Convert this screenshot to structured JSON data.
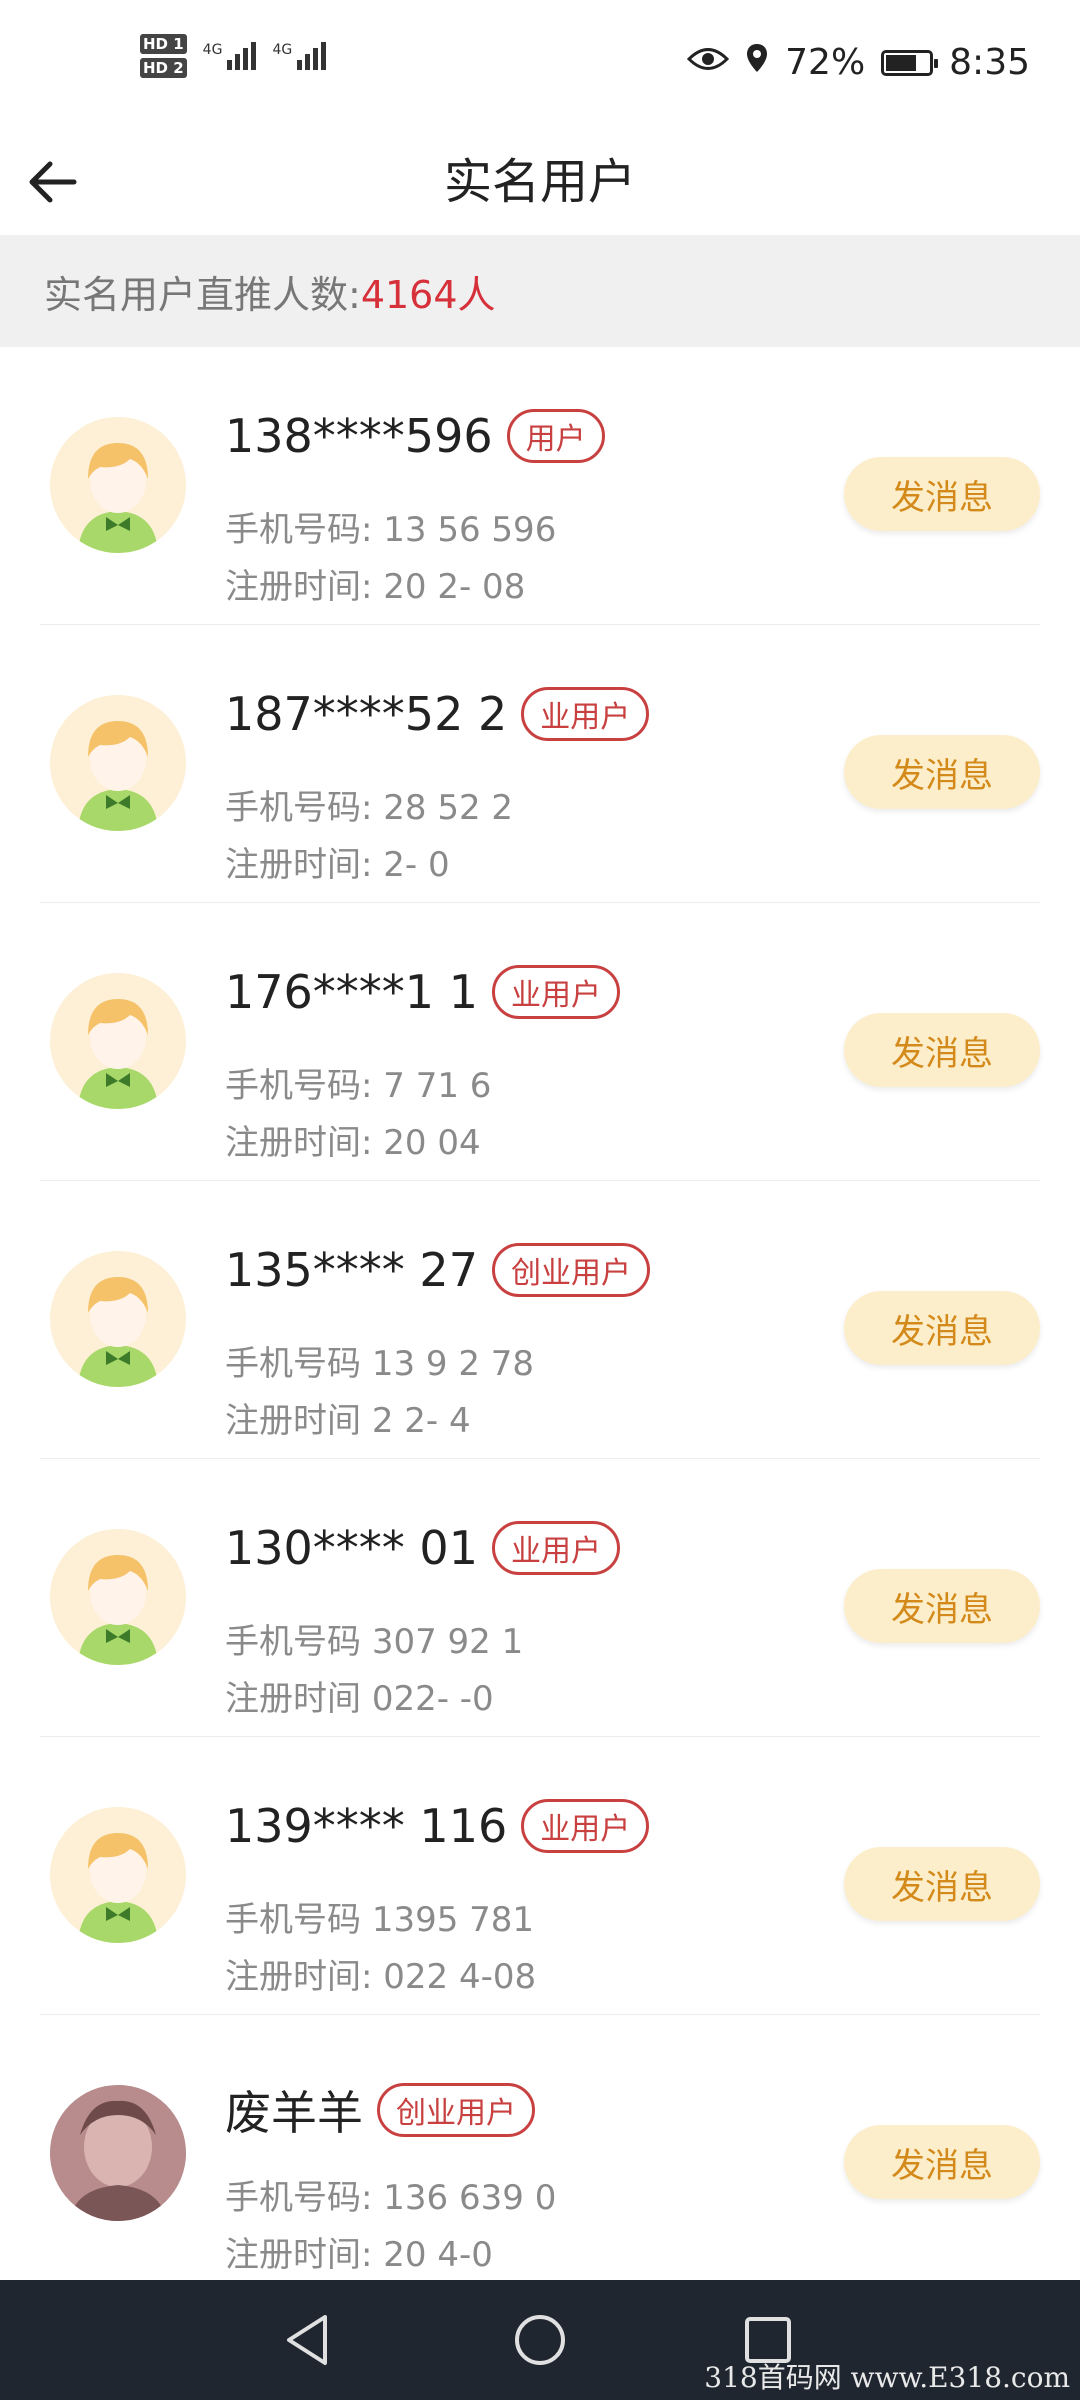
{
  "status_bar": {
    "hd1": "HD 1",
    "hd2": "HD 2",
    "net1": "4G",
    "net2": "4G",
    "battery_percent": "72%",
    "battery_level": 0.72,
    "time": "8:35"
  },
  "header": {
    "title": "实名用户"
  },
  "summary": {
    "label": "实名用户直推人数:",
    "count": "4164人"
  },
  "users": [
    {
      "name": "138****596",
      "badge": "用户",
      "phone_label": "手机号码:",
      "phone": "13  56   596",
      "reg_label": "注册时间:",
      "reg": "20  2-   08",
      "avatar": "default",
      "button": "发消息"
    },
    {
      "name": "187****52 2",
      "badge": "业用户",
      "phone_label": "手机号码:",
      "phone": "   28   52 2",
      "reg_label": "注册时间:",
      "reg": "   2-    0",
      "avatar": "default",
      "button": "发消息"
    },
    {
      "name": "176****1 1",
      "badge": "业用户",
      "phone_label": "手机号码:",
      "phone": " 7    71   6",
      "reg_label": "注册时间:",
      "reg": "20    04",
      "avatar": "default",
      "button": "发消息"
    },
    {
      "name": "135****  27",
      "badge": "创业用户",
      "phone_label": "手机号码",
      "phone": "13  9   2  78",
      "reg_label": "注册时间",
      "reg": "2  2-  4",
      "avatar": "default",
      "button": "发消息"
    },
    {
      "name": "130****  01",
      "badge": "业用户",
      "phone_label": "手机号码",
      "phone": " 307   92 1",
      "reg_label": "注册时间",
      "reg": " 022-   -0",
      "avatar": "default",
      "button": "发消息"
    },
    {
      "name": "139****  116",
      "badge": "业用户",
      "phone_label": "手机号码",
      "phone": " 1395   781",
      "reg_label": "注册时间:",
      "reg": " 022  4-08",
      "avatar": "default",
      "button": "发消息"
    },
    {
      "name": "废羊羊",
      "badge": "创业用户",
      "phone_label": "手机号码:",
      "phone": "136    639 0",
      "reg_label": "注册时间:",
      "reg": "20    4-0",
      "avatar": "photo",
      "button": "发消息"
    }
  ],
  "watermark": "318首码网 www.E318.com"
}
